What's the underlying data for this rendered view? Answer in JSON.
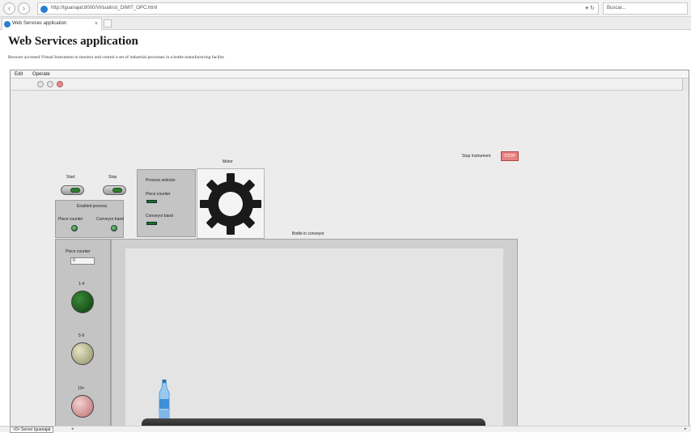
{
  "browser": {
    "address": "http://lguanajat:8000/Virtualinst_DIMIT_OPC.html",
    "refresh_glyph": "▾ ↻",
    "search_placeholder": "Buscar...",
    "tab_title": "Web Services application",
    "tab_close": "×"
  },
  "page": {
    "title": "Web Services application",
    "description": "Browser accessed Virtual Instrument to monitor and control a set of industrial processes in a bottle manufacturing facility"
  },
  "vi": {
    "menu": [
      "Edit",
      "Operate"
    ],
    "stop_instrument_label": "Stop Instrument",
    "stop_button_label": "STOP",
    "start_label": "Start",
    "stop_label": "Stop",
    "enabled_process": {
      "title": "Enabled process",
      "piece_counter": "Piece counter",
      "conveyor_band": "Conveyor band"
    },
    "process_selector": {
      "title": "Process selector",
      "piece_counter": "Piece counter",
      "conveyor_band": "Conveyor band"
    },
    "motor_label": "Motor",
    "bottle_label": "Bottle in conveyor",
    "counter": {
      "title": "Piece counter",
      "value": "0",
      "ranges": [
        {
          "label": "1-4",
          "color": "#145214"
        },
        {
          "label": "5-9",
          "color": "#b5b58e"
        },
        {
          "label": "10+",
          "color": "#d79a9a"
        }
      ]
    }
  },
  "status": {
    "server": "<0> Server lguanajat",
    "left_arrow": "◂",
    "right_arrow": "▸"
  },
  "colors": {
    "led_on": "#2e7d2e",
    "stop_red": "#e98080",
    "bottle_blue": "#3d8fd8"
  }
}
